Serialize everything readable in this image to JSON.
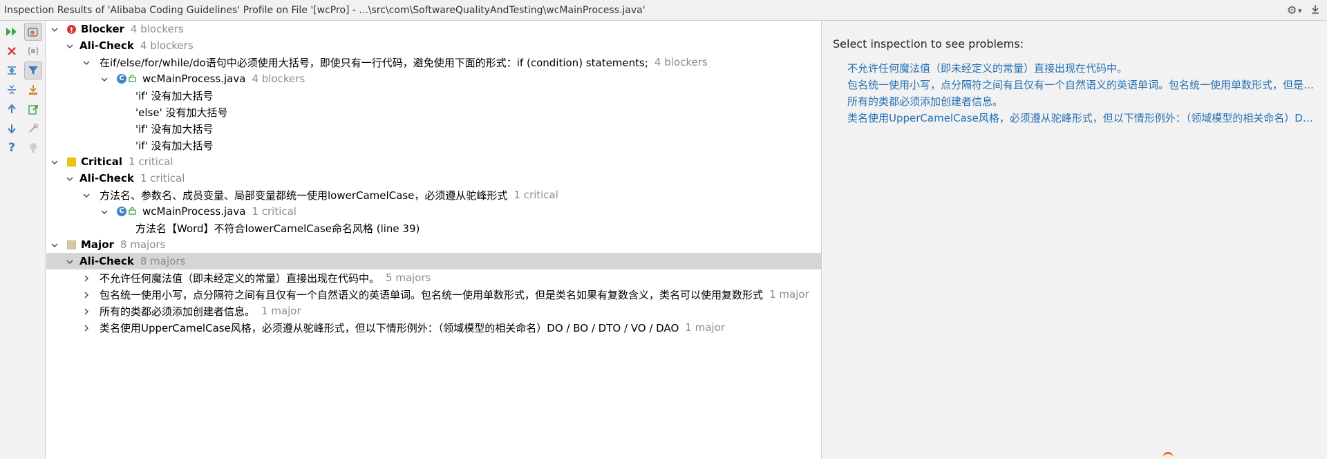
{
  "window": {
    "title": "Inspection Results of 'Alibaba Coding Guidelines' Profile on File '[wcPro] - ...\\src\\com\\SoftwareQualityAndTesting\\wcMainProcess.java'"
  },
  "toolbar": {
    "buttons": [
      "rerun-icon",
      "close-icon",
      "group-by-severity-icon",
      "expand-all-icon",
      "collapse-all-icon",
      "filter-icon",
      "export-icon",
      "previous-icon",
      "next-icon",
      "autoscroll-icon",
      "settings-icon",
      "help-icon",
      "quick-fix-icon"
    ]
  },
  "tree": {
    "blocker": {
      "label": "Blocker",
      "count": "4 blockers",
      "group": {
        "label": "Ali-Check",
        "count": "4 blockers"
      },
      "rule": {
        "label": "在if/else/for/while/do语句中必须使用大括号，即使只有一行代码，避免使用下面的形式：if (condition) statements;",
        "count": "4 blockers"
      },
      "file": {
        "label": "wcMainProcess.java",
        "count": "4 blockers"
      },
      "problems": [
        "'if' 没有加大括号",
        "'else' 没有加大括号",
        "'if' 没有加大括号",
        "'if' 没有加大括号"
      ]
    },
    "critical": {
      "label": "Critical",
      "count": "1 critical",
      "group": {
        "label": "Ali-Check",
        "count": "1 critical"
      },
      "rule": {
        "label": "方法名、参数名、成员变量、局部变量都统一使用lowerCamelCase，必须遵从驼峰形式",
        "count": "1 critical"
      },
      "file": {
        "label": "wcMainProcess.java",
        "count": "1 critical"
      },
      "problems": [
        "方法名【Word】不符合lowerCamelCase命名风格 (line 39)"
      ]
    },
    "major": {
      "label": "Major",
      "count": "8 majors",
      "group": {
        "label": "Ali-Check",
        "count": "8 majors"
      },
      "rules": [
        {
          "label": "不允许任何魔法值（即未经定义的常量）直接出现在代码中。",
          "count": "5 majors"
        },
        {
          "label": "包名统一使用小写，点分隔符之间有且仅有一个自然语义的英语单词。包名统一使用单数形式，但是类名如果有复数含义，类名可以使用复数形式",
          "count": "1 major"
        },
        {
          "label": "所有的类都必须添加创建者信息。",
          "count": "1 major"
        },
        {
          "label": "类名使用UpperCamelCase风格，必须遵从驼峰形式，但以下情形例外：（领域模型的相关命名）DO / BO / DTO / VO / DAO",
          "count": "1 major"
        }
      ]
    }
  },
  "detail": {
    "title": "Select inspection to see problems:",
    "links": [
      "不允许任何魔法值（即未经定义的常量）直接出现在代码中。",
      "包名统一使用小写，点分隔符之间有且仅有一个自然语义的英语单词。包名统一使用单数形式，但是类...",
      "所有的类都必须添加创建者信息。",
      "类名使用UpperCamelCase风格，必须遵从驼峰形式，但以下情形例外：（领域模型的相关命名）DO ..."
    ]
  },
  "colors": {
    "blocker": "#d8392b",
    "critical": "#eac20a",
    "major": "#d9c8a4",
    "link": "#2470b3",
    "selection": "#d5d5d5"
  }
}
